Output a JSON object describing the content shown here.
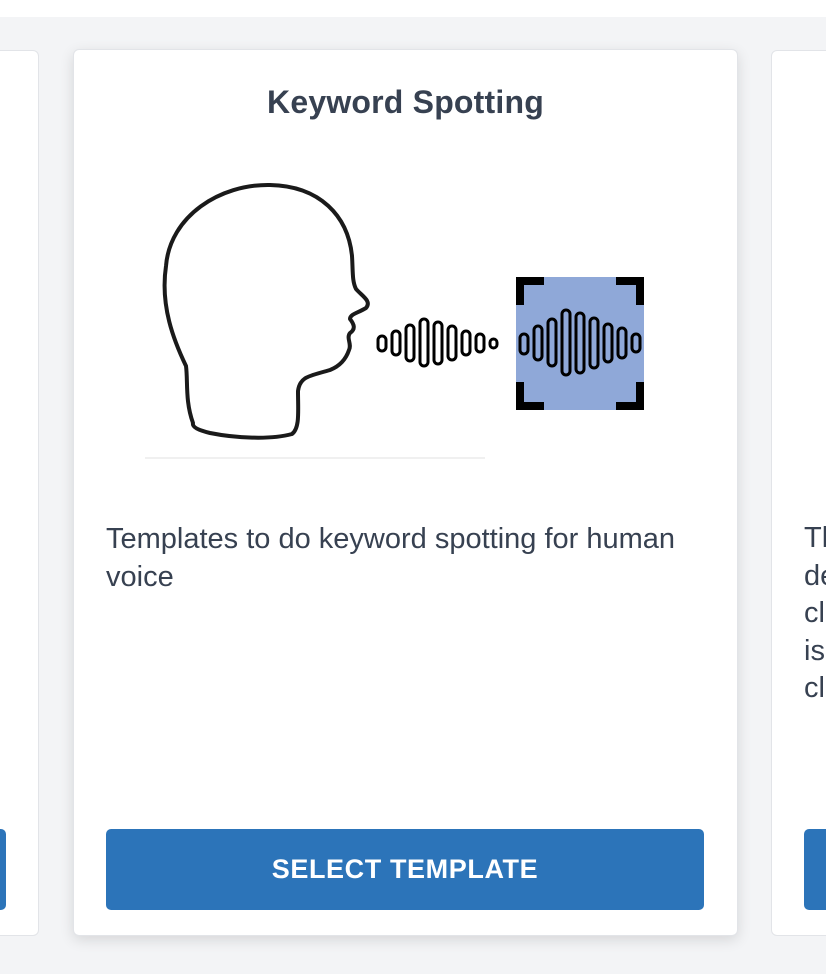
{
  "main_card": {
    "title": "Keyword Spotting",
    "illustration_icon": "head-speaking-waveform-icon",
    "description": "Templates to do keyword spotting for human voice",
    "select_button_label": "SELECT TEMPLATE"
  },
  "right_card": {
    "description_fragments": [
      "Th",
      "de",
      "cl",
      "is",
      "cl"
    ]
  },
  "colors": {
    "accent": "#2c74b9",
    "waveform_highlight": "#8fa8d8",
    "text": "#374151",
    "background": "#f3f4f6"
  }
}
